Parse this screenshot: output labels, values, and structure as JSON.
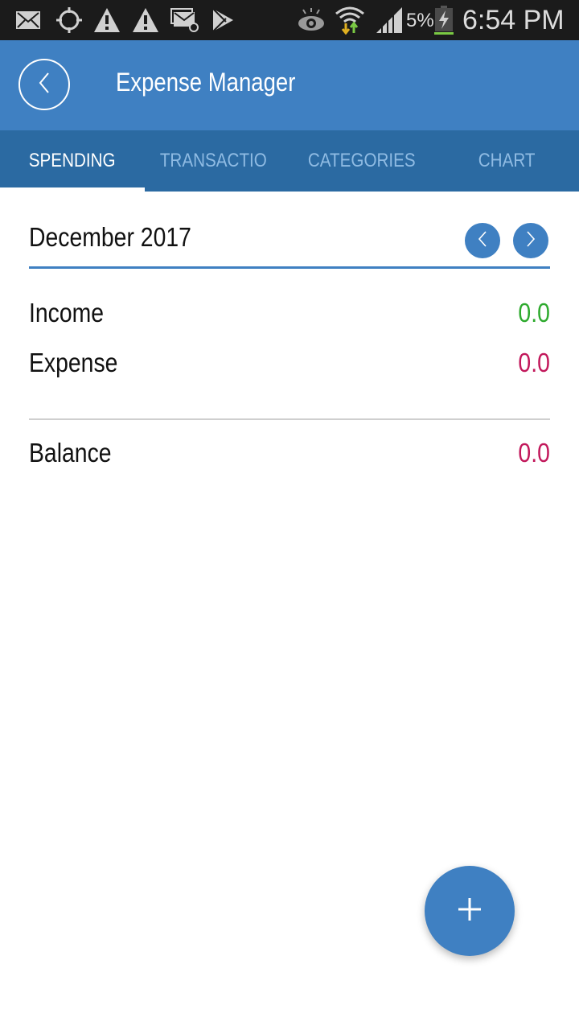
{
  "status_bar": {
    "icons_left": [
      "mail-icon",
      "gps-icon",
      "warning-icon",
      "warning-icon",
      "email-at-icon",
      "play-store-icon"
    ],
    "icons_right": [
      "eye-icon",
      "wifi-icon",
      "signal-icon",
      "battery-charging-icon"
    ],
    "battery_percent": "5%",
    "time": "6:54 PM"
  },
  "app_bar": {
    "back_icon": "chevron-left-icon",
    "title": "Expense Manager"
  },
  "tabs": [
    {
      "label": "SPENDING",
      "active": true
    },
    {
      "label": "TRANSACTIO",
      "active": false
    },
    {
      "label": "CATEGORIES",
      "active": false
    },
    {
      "label": "CHART",
      "active": false
    }
  ],
  "period": {
    "label": "December 2017",
    "prev_icon": "chevron-left-icon",
    "next_icon": "chevron-right-icon"
  },
  "summary": {
    "income": {
      "label": "Income",
      "value": "0.0",
      "color": "#2eaa2e"
    },
    "expense": {
      "label": "Expense",
      "value": "0.0",
      "color": "#c2185b"
    },
    "balance": {
      "label": "Balance",
      "value": "0.0",
      "color": "#c2185b"
    }
  },
  "fab": {
    "icon": "plus-icon"
  },
  "colors": {
    "primary": "#3f80c2",
    "tab_bar": "#2b6aa2",
    "status_bar": "#1b1b1b"
  }
}
